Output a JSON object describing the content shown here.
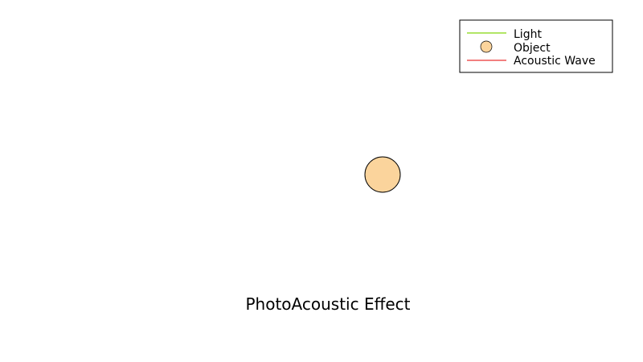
{
  "diagram": {
    "title": "PhotoAcoustic Effect",
    "object": {
      "fill": "#fbd49c",
      "stroke": "#000000"
    }
  },
  "legend": {
    "items": [
      {
        "label": "Light",
        "marker": "line",
        "color": "#99dd33"
      },
      {
        "label": "Object",
        "marker": "circle",
        "color": "#fbd49c"
      },
      {
        "label": "Acoustic Wave",
        "marker": "line",
        "color": "#ee5555"
      }
    ]
  }
}
